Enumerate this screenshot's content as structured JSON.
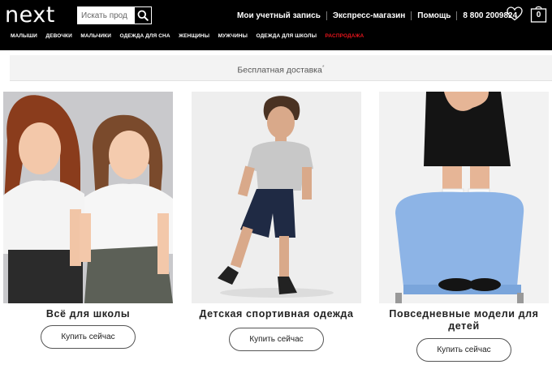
{
  "header": {
    "logo": "next",
    "search_placeholder": "Искать прод",
    "links": [
      "Мои учетный запись",
      "Экспресс-магазин",
      "Помощь",
      "8 800 2009824"
    ],
    "bag_count": "0"
  },
  "nav": [
    "МАЛЫШИ",
    "ДЕВОЧКИ",
    "МАЛЬЧИКИ",
    "ОДЕЖДА ДЛЯ СНА",
    "ЖЕНЩИНЫ",
    "МУЖЧИНЫ",
    "ОДЕЖДА ДЛЯ ШКОЛЫ",
    "РАСПРОДАЖА"
  ],
  "banner": {
    "text": "Бесплатная доставка",
    "mark": "*"
  },
  "cards": [
    {
      "title": "Всё для школы",
      "button": "Купить сейчас"
    },
    {
      "title": "Детская спортивная одежда",
      "button": "Купить сейчас"
    },
    {
      "title": "Повседневные модели для детей",
      "button": "Купить сейчас"
    }
  ],
  "colors": {
    "header_bg": "#000000",
    "sale": "#e4141b",
    "banner_bg": "#f3f3f3"
  }
}
